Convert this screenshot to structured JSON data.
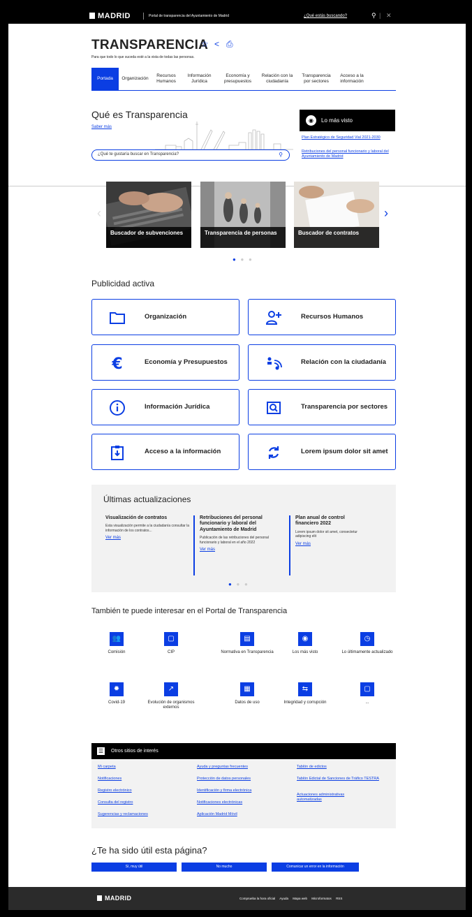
{
  "topbar": {
    "logo": "MADRID",
    "portal": "Portal de transparencia del Ayuntamiento de Madrid",
    "ask": "¿Qué estás buscando?",
    "icons": [
      "search-icon",
      "close-icon"
    ]
  },
  "header": {
    "title": "TRANSPARENCIA",
    "subtitle": "Para que todo lo que suceda esté a la vista de todas las personas.",
    "icons": [
      "star-icon",
      "share-icon",
      "print-icon"
    ]
  },
  "nav": {
    "tabs": [
      {
        "label": "Portada",
        "active": true
      },
      {
        "label": "Organización"
      },
      {
        "label": "Recursos Humanos"
      },
      {
        "label": "Información Jurídica"
      },
      {
        "label": "Economía y presupuestos"
      },
      {
        "label": "Relación con la ciudadanía"
      },
      {
        "label": "Transparencia por sectores"
      },
      {
        "label": "Acceso a la información"
      }
    ]
  },
  "intro": {
    "heading": "Qué es Transparencia",
    "saber": "Saber más",
    "search_placeholder": "¿Qué te gustaría buscar en Transparencia?"
  },
  "lomasvisto": {
    "title": "Lo más visto",
    "links": [
      "Plan Estratégico de Seguridad Vial 2021-2030",
      "Retribuciones del personal funcionario y laboral del Ayuntamiento de Madrid"
    ]
  },
  "carousel": {
    "cards": [
      "Buscador de subvenciones",
      "Transparencia de personas",
      "Buscador de contratos"
    ],
    "active_dot": 0,
    "dot_count": 3
  },
  "publicidad": {
    "heading": "Publicidad activa",
    "items": [
      {
        "label": "Organización",
        "icon": "folder-icon"
      },
      {
        "label": "Recursos Humanos",
        "icon": "add-user-icon"
      },
      {
        "label": "Economía y Presupuestos",
        "icon": "euro-icon"
      },
      {
        "label": "Relación con la ciudadanía",
        "icon": "people-talk-icon"
      },
      {
        "label": "Información Jurídica",
        "icon": "info-icon"
      },
      {
        "label": "Transparencia por sectores",
        "icon": "search-box-icon"
      },
      {
        "label": "Acceso a la información",
        "icon": "download-clipboard-icon"
      },
      {
        "label": "Lorem ipsum dolor sit amet",
        "icon": "refresh-icon"
      }
    ]
  },
  "updates": {
    "heading": "Últimas actualizaciones",
    "items": [
      {
        "title": "Visualización de contratos",
        "desc": "Esta visualización permite a la ciudadanía consultar la información de los contratos...",
        "link": "Ver más"
      },
      {
        "title": "Retribuciones del personal funcionario y laboral del Ayuntamiento de Madrid",
        "desc": "Publicación de las retribuciones del personal funcionario y laboral en el año 2022",
        "link": "Ver más"
      },
      {
        "title": "Plan anual de control financiero 2022",
        "desc": "Lorem ipsum dolor sit amet, consectetur adipiscing elit",
        "link": "Ver más"
      }
    ]
  },
  "interest": {
    "heading": "También te puede interesar en el Portal de Transparencia",
    "items": [
      {
        "label": "Comisión",
        "icon": "group-icon"
      },
      {
        "label": "CIP",
        "icon": "briefcase-icon"
      },
      {
        "label": "Normativa en Transparencia",
        "icon": "document-icon"
      },
      {
        "label": "Los más visto",
        "icon": "eye-icon"
      },
      {
        "label": "Lo últimamente actualizado",
        "icon": "clock-icon"
      },
      {
        "label": "Covid-19",
        "icon": "virus-icon"
      },
      {
        "label": "Evolución de organismos externos",
        "icon": "trend-icon"
      },
      {
        "label": "Datos de uso",
        "icon": "data-icon"
      },
      {
        "label": "Integridad y corrupción",
        "icon": "handshake-icon"
      },
      {
        "label": "...",
        "icon": "briefcase-icon"
      }
    ]
  },
  "otros": {
    "heading": "Otros sitios de interés",
    "col1": [
      "Mi carpeta",
      "Notificaciones",
      "Registro electrónico",
      "Consulta del registro",
      "Sugerencias y reclamaciones"
    ],
    "col2": [
      "Ayuda y preguntas frecuentes",
      "Protección de datos personales",
      "Identificación y firma electrónica",
      "Notificaciones electrónicas",
      "Aplicación Madrid Móvil"
    ],
    "col3": [
      "Tablón de edictos",
      "Tablón Edictal de Sanciones de Tráfico TESTRA",
      "Actuaciones administrativas automatizadas"
    ]
  },
  "util": {
    "heading": "¿Te ha sido útil esta página?",
    "buttons": [
      "Sí, muy útil",
      "No mucho",
      "Comunicar un error en la información"
    ]
  },
  "footer": {
    "logo": "MADRID",
    "links": [
      "Comprueba la hora oficial",
      "Ayuda",
      "Mapa web",
      "Microformatos",
      "RSS"
    ]
  },
  "colors": {
    "accent": "#0b3ee3",
    "dark": "#000000",
    "footer": "#2b2b2b",
    "panel": "#f2f2f2"
  }
}
